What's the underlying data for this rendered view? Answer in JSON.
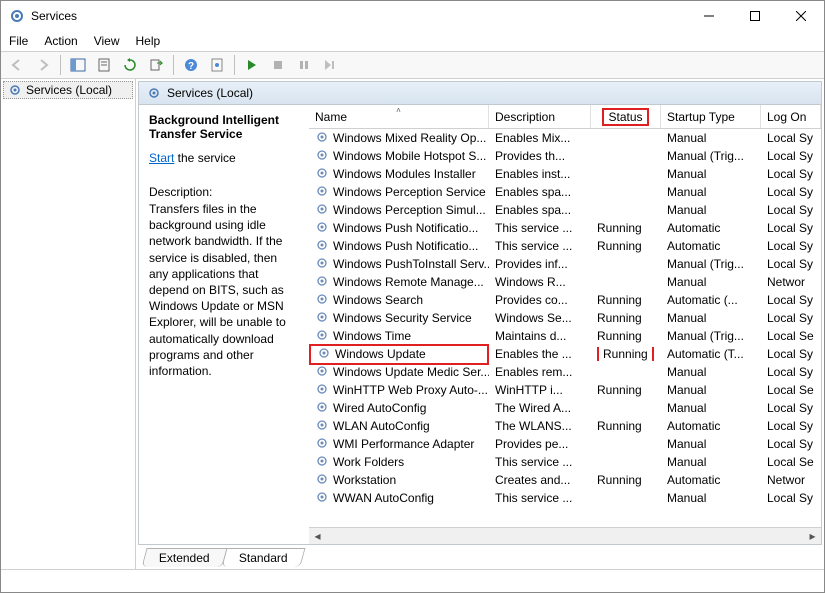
{
  "window": {
    "title": "Services"
  },
  "menu": {
    "file": "File",
    "action": "Action",
    "view": "View",
    "help": "Help"
  },
  "tree": {
    "root": "Services (Local)"
  },
  "pane": {
    "header": "Services (Local)"
  },
  "detail": {
    "name": "Background Intelligent Transfer Service",
    "start_link": "Start",
    "start_rest": " the service",
    "desc_label": "Description:",
    "desc_text": "Transfers files in the background using idle network bandwidth. If the service is disabled, then any applications that depend on BITS, such as Windows Update or MSN Explorer, will be unable to automatically download programs and other information."
  },
  "columns": {
    "name": "Name",
    "description": "Description",
    "status": "Status",
    "startup": "Startup Type",
    "logon": "Log On"
  },
  "services": [
    {
      "name": "Windows Mixed Reality Op...",
      "desc": "Enables Mix...",
      "status": "",
      "startup": "Manual",
      "logon": "Local Sy"
    },
    {
      "name": "Windows Mobile Hotspot S...",
      "desc": "Provides th...",
      "status": "",
      "startup": "Manual (Trig...",
      "logon": "Local Sy"
    },
    {
      "name": "Windows Modules Installer",
      "desc": "Enables inst...",
      "status": "",
      "startup": "Manual",
      "logon": "Local Sy"
    },
    {
      "name": "Windows Perception Service",
      "desc": "Enables spa...",
      "status": "",
      "startup": "Manual",
      "logon": "Local Sy"
    },
    {
      "name": "Windows Perception Simul...",
      "desc": "Enables spa...",
      "status": "",
      "startup": "Manual",
      "logon": "Local Sy"
    },
    {
      "name": "Windows Push Notificatio...",
      "desc": "This service ...",
      "status": "Running",
      "startup": "Automatic",
      "logon": "Local Sy"
    },
    {
      "name": "Windows Push Notificatio...",
      "desc": "This service ...",
      "status": "Running",
      "startup": "Automatic",
      "logon": "Local Sy"
    },
    {
      "name": "Windows PushToInstall Serv...",
      "desc": "Provides inf...",
      "status": "",
      "startup": "Manual (Trig...",
      "logon": "Local Sy"
    },
    {
      "name": "Windows Remote Manage...",
      "desc": "Windows R...",
      "status": "",
      "startup": "Manual",
      "logon": "Networ"
    },
    {
      "name": "Windows Search",
      "desc": "Provides co...",
      "status": "Running",
      "startup": "Automatic (...",
      "logon": "Local Sy"
    },
    {
      "name": "Windows Security Service",
      "desc": "Windows Se...",
      "status": "Running",
      "startup": "Manual",
      "logon": "Local Sy"
    },
    {
      "name": "Windows Time",
      "desc": "Maintains d...",
      "status": "Running",
      "startup": "Manual (Trig...",
      "logon": "Local Se"
    },
    {
      "name": "Windows Update",
      "desc": "Enables the ...",
      "status": "Running",
      "startup": "Automatic (T...",
      "logon": "Local Sy",
      "highlight": true
    },
    {
      "name": "Windows Update Medic Ser...",
      "desc": "Enables rem...",
      "status": "",
      "startup": "Manual",
      "logon": "Local Sy"
    },
    {
      "name": "WinHTTP Web Proxy Auto-...",
      "desc": "WinHTTP i...",
      "status": "Running",
      "startup": "Manual",
      "logon": "Local Se"
    },
    {
      "name": "Wired AutoConfig",
      "desc": "The Wired A...",
      "status": "",
      "startup": "Manual",
      "logon": "Local Sy"
    },
    {
      "name": "WLAN AutoConfig",
      "desc": "The WLANS...",
      "status": "Running",
      "startup": "Automatic",
      "logon": "Local Sy"
    },
    {
      "name": "WMI Performance Adapter",
      "desc": "Provides pe...",
      "status": "",
      "startup": "Manual",
      "logon": "Local Sy"
    },
    {
      "name": "Work Folders",
      "desc": "This service ...",
      "status": "",
      "startup": "Manual",
      "logon": "Local Se"
    },
    {
      "name": "Workstation",
      "desc": "Creates and...",
      "status": "Running",
      "startup": "Automatic",
      "logon": "Networ"
    },
    {
      "name": "WWAN AutoConfig",
      "desc": "This service ...",
      "status": "",
      "startup": "Manual",
      "logon": "Local Sy"
    }
  ],
  "tabs": {
    "extended": "Extended",
    "standard": "Standard"
  }
}
